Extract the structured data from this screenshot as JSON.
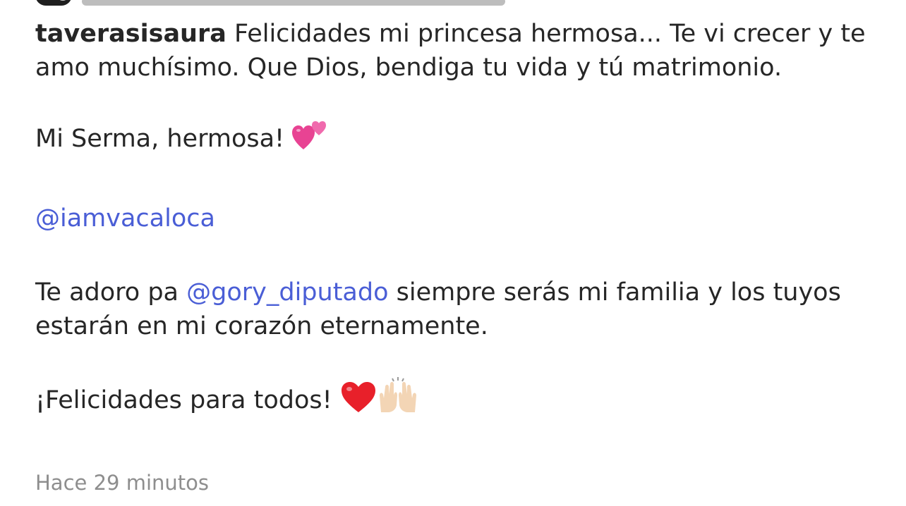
{
  "comment": {
    "username": "taverasisaura",
    "line1_text": " Felicidades mi princesa hermosa... Te vi crecer y te amo muchísimo. Que Dios, bendiga tu vida y tú matrimonio.",
    "line2_text": "Mi Serma, hermosa! ",
    "line2_emoji": "two-hearts-emoji",
    "mention1": "@iamvacaloca",
    "line4_prefix": "Te adoro pa ",
    "mention2": "@gory_diputado",
    "line4_suffix": " siempre serás mi familia y los tuyos estarán en mi corazón eternamente.",
    "line5_text": "¡Felicidades para todos! ",
    "line5_emojis": [
      "red-heart-emoji",
      "raising-hands-emoji"
    ]
  },
  "timestamp": "Hace 29 minutos",
  "colors": {
    "text": "#262626",
    "mention": "#4a5ed6",
    "timestamp": "#8e8e8e",
    "heart_pink": "#e84393",
    "heart_red": "#e8202a"
  }
}
